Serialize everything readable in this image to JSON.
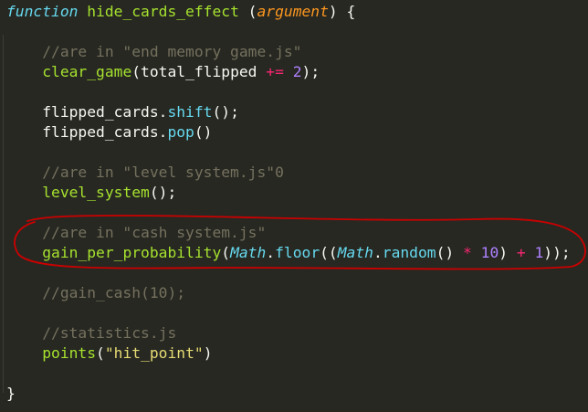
{
  "editor": {
    "theme_colors": {
      "background": "#272822",
      "keyword": "#66d9ef",
      "function": "#a6e22e",
      "parameter": "#fd971f",
      "number": "#ae81ff",
      "operator": "#f92672",
      "string": "#e6db74",
      "comment": "#75715e",
      "annotation": "#cc0000"
    },
    "lines": [
      {
        "tokens": [
          {
            "text": "function",
            "kind": "kw"
          },
          {
            "text": " ",
            "kind": "plain"
          },
          {
            "text": "hide_cards_effect",
            "kind": "fn"
          },
          {
            "text": " (",
            "kind": "plain"
          },
          {
            "text": "argument",
            "kind": "param"
          },
          {
            "text": ") {",
            "kind": "plain"
          }
        ]
      },
      {
        "tokens": []
      },
      {
        "tokens": [
          {
            "text": "    //are in \"end memory game.js\"",
            "kind": "cmt"
          }
        ]
      },
      {
        "tokens": [
          {
            "text": "    ",
            "kind": "plain"
          },
          {
            "text": "clear_game",
            "kind": "fn"
          },
          {
            "text": "(total_flipped ",
            "kind": "plain"
          },
          {
            "text": "+=",
            "kind": "op"
          },
          {
            "text": " ",
            "kind": "plain"
          },
          {
            "text": "2",
            "kind": "num"
          },
          {
            "text": ");",
            "kind": "plain"
          }
        ]
      },
      {
        "tokens": []
      },
      {
        "tokens": [
          {
            "text": "    flipped_cards.",
            "kind": "plain"
          },
          {
            "text": "shift",
            "kind": "method"
          },
          {
            "text": "();",
            "kind": "plain"
          }
        ]
      },
      {
        "tokens": [
          {
            "text": "    flipped_cards.",
            "kind": "plain"
          },
          {
            "text": "pop",
            "kind": "method"
          },
          {
            "text": "()",
            "kind": "plain"
          }
        ]
      },
      {
        "tokens": []
      },
      {
        "tokens": [
          {
            "text": "    //are in \"level system.js\"0",
            "kind": "cmt"
          }
        ]
      },
      {
        "tokens": [
          {
            "text": "    ",
            "kind": "plain"
          },
          {
            "text": "level_system",
            "kind": "fn"
          },
          {
            "text": "();",
            "kind": "plain"
          }
        ]
      },
      {
        "tokens": []
      },
      {
        "tokens": [
          {
            "text": "    //are in \"cash system.js\"",
            "kind": "cmt"
          }
        ]
      },
      {
        "tokens": [
          {
            "text": "    ",
            "kind": "plain"
          },
          {
            "text": "gain_per_probability",
            "kind": "fn"
          },
          {
            "text": "(",
            "kind": "plain"
          },
          {
            "text": "Math",
            "kind": "obj"
          },
          {
            "text": ".",
            "kind": "plain"
          },
          {
            "text": "floor",
            "kind": "method"
          },
          {
            "text": "((",
            "kind": "plain"
          },
          {
            "text": "Math",
            "kind": "obj"
          },
          {
            "text": ".",
            "kind": "plain"
          },
          {
            "text": "random",
            "kind": "method"
          },
          {
            "text": "() ",
            "kind": "plain"
          },
          {
            "text": "*",
            "kind": "op"
          },
          {
            "text": " ",
            "kind": "plain"
          },
          {
            "text": "10",
            "kind": "num"
          },
          {
            "text": ") ",
            "kind": "plain"
          },
          {
            "text": "+",
            "kind": "op"
          },
          {
            "text": " ",
            "kind": "plain"
          },
          {
            "text": "1",
            "kind": "num"
          },
          {
            "text": "));",
            "kind": "plain"
          }
        ]
      },
      {
        "tokens": []
      },
      {
        "tokens": [
          {
            "text": "    //gain_cash(10);",
            "kind": "cmt"
          }
        ]
      },
      {
        "tokens": []
      },
      {
        "tokens": [
          {
            "text": "    //statistics.js",
            "kind": "cmt"
          }
        ]
      },
      {
        "tokens": [
          {
            "text": "    ",
            "kind": "plain"
          },
          {
            "text": "points",
            "kind": "fn"
          },
          {
            "text": "(",
            "kind": "plain"
          },
          {
            "text": "\"hit_point\"",
            "kind": "str"
          },
          {
            "text": ")",
            "kind": "plain"
          }
        ]
      },
      {
        "tokens": []
      },
      {
        "tokens": [
          {
            "text": "}",
            "kind": "plain"
          }
        ]
      }
    ]
  }
}
